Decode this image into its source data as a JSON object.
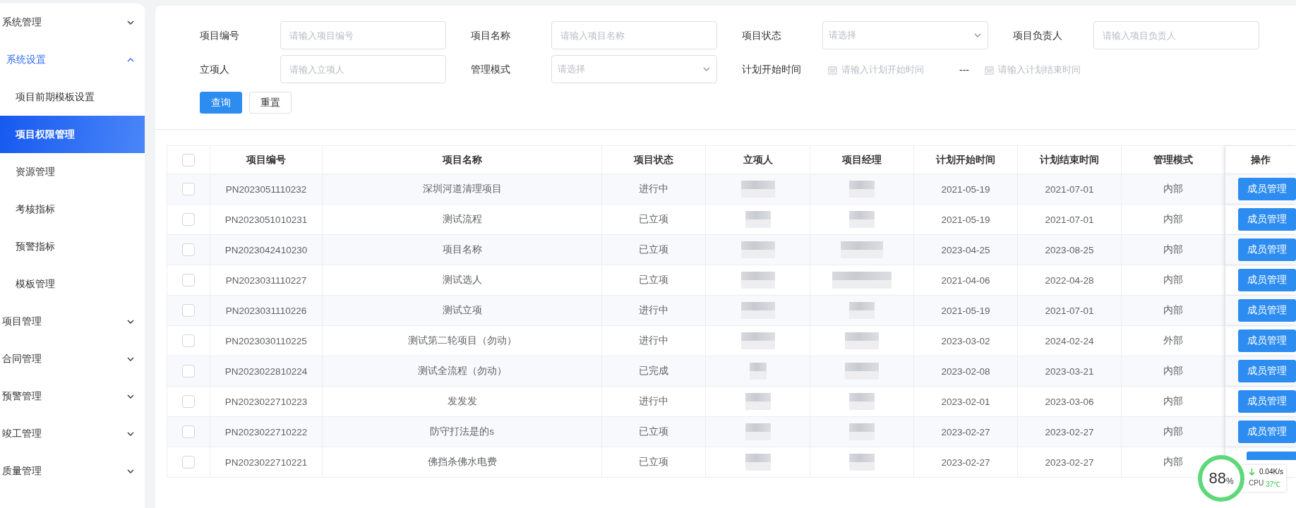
{
  "sidebar": {
    "items": [
      {
        "label": "系统管理",
        "expanded": false,
        "active": false
      },
      {
        "label": "系统设置",
        "expanded": true,
        "active": true,
        "children": [
          {
            "label": "项目前期模板设置",
            "selected": false
          },
          {
            "label": "项目权限管理",
            "selected": true
          },
          {
            "label": "资源管理",
            "selected": false
          },
          {
            "label": "考核指标",
            "selected": false
          },
          {
            "label": "预警指标",
            "selected": false
          },
          {
            "label": "模板管理",
            "selected": false
          }
        ]
      },
      {
        "label": "项目管理",
        "expanded": false,
        "active": false
      },
      {
        "label": "合同管理",
        "expanded": false,
        "active": false
      },
      {
        "label": "预警管理",
        "expanded": false,
        "active": false
      },
      {
        "label": "竣工管理",
        "expanded": false,
        "active": false
      },
      {
        "label": "质量管理",
        "expanded": false,
        "active": false
      }
    ]
  },
  "filters": [
    {
      "label": "项目编号",
      "kind": "input",
      "placeholder": "请输入项目编号"
    },
    {
      "label": "项目名称",
      "kind": "input",
      "placeholder": "请输入项目名称"
    },
    {
      "label": "项目状态",
      "kind": "select",
      "placeholder": "请选择"
    },
    {
      "label": "项目负责人",
      "kind": "input",
      "placeholder": "请输入项目负责人"
    },
    {
      "label": "立项人",
      "kind": "input",
      "placeholder": "请输入立项人"
    },
    {
      "label": "管理模式",
      "kind": "select",
      "placeholder": "请选择"
    },
    {
      "label": "计划开始时间",
      "kind": "daterange",
      "placeholder": "请输入计划开始时间",
      "separator": "---",
      "placeholder_end": "请输入计划结束时间"
    }
  ],
  "buttons": [
    {
      "label": "查询",
      "kind": "primary"
    },
    {
      "label": "重置",
      "kind": "default"
    }
  ],
  "table": {
    "all_checked": false,
    "columns": [
      "项目编号",
      "项目名称",
      "项目状态",
      "立项人",
      "项目经理",
      "计划开始时间",
      "计划结束时间",
      "管理模式",
      "操作"
    ],
    "rows": [
      {
        "checked": false,
        "code": "PN2023051110232",
        "name": "深圳河道清理项目",
        "status": "进行中",
        "start": "2021-05-19",
        "end": "2021-07-01",
        "mode": "内部",
        "action": "成员管理"
      },
      {
        "checked": false,
        "code": "PN2023051010231",
        "name": "测试流程",
        "status": "已立项",
        "start": "2021-05-19",
        "end": "2021-07-01",
        "mode": "内部",
        "action": "成员管理"
      },
      {
        "checked": false,
        "code": "PN2023042410230",
        "name": "项目名称",
        "status": "已立项",
        "start": "2023-04-25",
        "end": "2023-08-25",
        "mode": "内部",
        "action": "成员管理"
      },
      {
        "checked": false,
        "code": "PN2023031110227",
        "name": "测试选人",
        "status": "已立项",
        "start": "2021-04-06",
        "end": "2022-04-28",
        "mode": "内部",
        "action": "成员管理"
      },
      {
        "checked": false,
        "code": "PN2023031110226",
        "name": "测试立项",
        "status": "进行中",
        "start": "2021-05-19",
        "end": "2021-07-01",
        "mode": "内部",
        "action": "成员管理"
      },
      {
        "checked": false,
        "code": "PN2023030110225",
        "name": "测试第二轮项目（勿动）",
        "status": "进行中",
        "start": "2023-03-02",
        "end": "2024-02-24",
        "mode": "外部",
        "action": "成员管理"
      },
      {
        "checked": false,
        "code": "PN2023022810224",
        "name": "测试全流程（勿动）",
        "status": "已完成",
        "start": "2023-02-08",
        "end": "2023-03-21",
        "mode": "内部",
        "action": "成员管理"
      },
      {
        "checked": false,
        "code": "PN2023022710223",
        "name": "发发发",
        "status": "进行中",
        "start": "2023-02-01",
        "end": "2023-03-06",
        "mode": "内部",
        "action": "成员管理"
      },
      {
        "checked": false,
        "code": "PN2023022710222",
        "name": "防守打法是的s",
        "status": "已立项",
        "start": "2023-02-27",
        "end": "2023-02-27",
        "mode": "内部",
        "action": "成员管理"
      },
      {
        "checked": false,
        "code": "PN2023022710221",
        "name": "佛挡杀佛水电费",
        "status": "已立项",
        "start": "2023-02-27",
        "end": "2023-02-27",
        "mode": "内部"
      }
    ]
  },
  "monitor": {
    "percent": "88",
    "unit": "%",
    "download": "0.04K/s",
    "cpu_label": "CPU",
    "cpu_temp": "37℃"
  }
}
